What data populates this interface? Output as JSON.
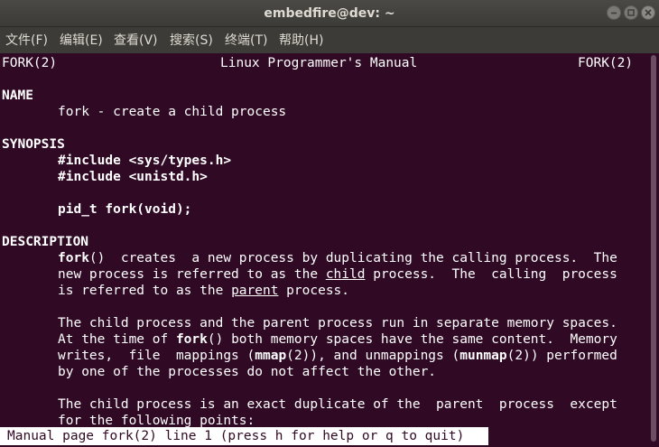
{
  "window": {
    "title": "embedfire@dev: ~"
  },
  "menu": [
    "文件(F)",
    "编辑(E)",
    "查看(V)",
    "搜索(S)",
    "终端(T)",
    "帮助(H)"
  ],
  "man": {
    "header_left": "FORK(2)",
    "header_center": "Linux Programmer's Manual",
    "header_right": "FORK(2)",
    "name_heading": "NAME",
    "name_text": "fork - create a child process",
    "synopsis_heading": "SYNOPSIS",
    "include_1": "#include <sys/types.h>",
    "include_2": "#include <unistd.h>",
    "prototype": "pid_t fork(void);",
    "description_heading": "DESCRIPTION",
    "d1_fork": "fork",
    "d1_rest": "()  creates  a new process by duplicating the calling process.  The",
    "d2_a": "new process is referred to as the ",
    "d2_child": "child",
    "d2_b": " process.  The  calling  process",
    "d3_a": "is referred to as the ",
    "d3_parent": "parent",
    "d3_b": " process.",
    "p2_l1": "The child process and the parent process run in separate memory spaces.",
    "p2_l2_a": "At the time of ",
    "p2_l2_fork": "fork",
    "p2_l2_b": "() both memory spaces have the same content.  Memory",
    "p2_l3_a": "writes,  file  mappings (",
    "p2_l3_mmap": "mmap",
    "p2_l3_b": "(2)), and unmappings (",
    "p2_l3_munmap": "munmap",
    "p2_l3_c": "(2)) performed",
    "p2_l4": "by one of the processes do not affect the other.",
    "p3_l1": "The child process is an exact duplicate of the  parent  process  except",
    "p3_l2": "for the following points:"
  },
  "status": "Manual page fork(2) line 1 (press h for help or q to quit)",
  "colors": {
    "terminal_bg": "#300a24",
    "terminal_fg": "#ffffff",
    "titlebar_bg": "#3c3b37",
    "menu_fg": "#dfdbd2"
  }
}
